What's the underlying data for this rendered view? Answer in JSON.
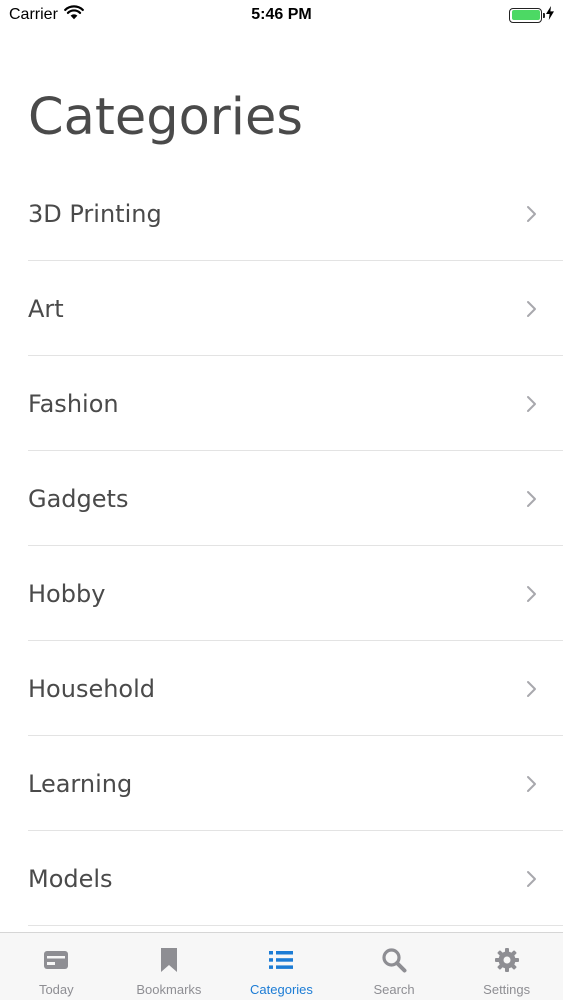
{
  "status_bar": {
    "carrier": "Carrier",
    "time": "5:46 PM"
  },
  "title": "Categories",
  "categories": [
    {
      "label": "3D Printing"
    },
    {
      "label": "Art"
    },
    {
      "label": "Fashion"
    },
    {
      "label": "Gadgets"
    },
    {
      "label": "Hobby"
    },
    {
      "label": "Household"
    },
    {
      "label": "Learning"
    },
    {
      "label": "Models"
    }
  ],
  "tab_bar": {
    "tabs": [
      {
        "label": "Today",
        "icon": "card-icon",
        "active": false
      },
      {
        "label": "Bookmarks",
        "icon": "bookmark-icon",
        "active": false
      },
      {
        "label": "Categories",
        "icon": "list-icon",
        "active": true
      },
      {
        "label": "Search",
        "icon": "search-icon",
        "active": false
      },
      {
        "label": "Settings",
        "icon": "gear-icon",
        "active": false
      }
    ]
  },
  "colors": {
    "accent": "#1c7cd5",
    "inactive": "#8e8e93",
    "text": "#4a4a4a",
    "battery": "#4cd964"
  }
}
